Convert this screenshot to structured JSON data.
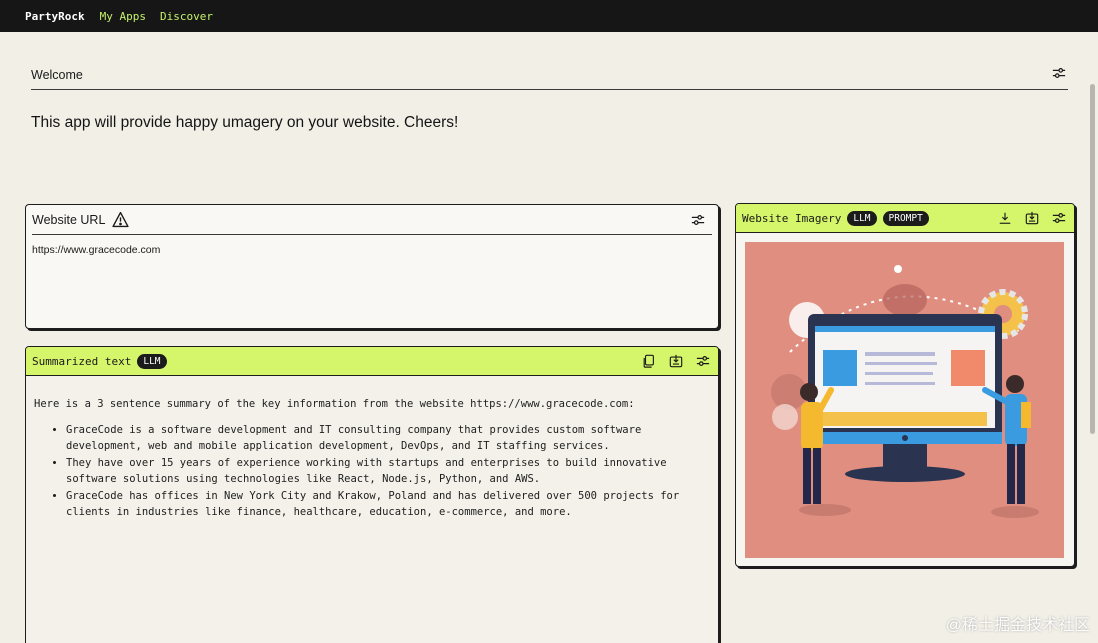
{
  "topbar": {
    "brand": "PartyRock",
    "nav": [
      "My Apps",
      "Discover"
    ]
  },
  "welcome": {
    "title": "Welcome",
    "description": "This app will provide happy umagery on your website. Cheers!"
  },
  "url_widget": {
    "title": "Website URL",
    "value": "https://www.gracecode.com"
  },
  "summary_widget": {
    "title": "Summarized text",
    "badge": "LLM",
    "intro": "Here is a 3 sentence summary of the key information from the website https://www.gracecode.com:",
    "bullets": [
      "GraceCode is a software development and IT consulting company that provides custom software development, web and mobile application development, DevOps, and IT staffing services.",
      "They have over 15 years of experience working with startups and enterprises to build innovative software solutions using technologies like React, Node.js, Python, and AWS.",
      "GraceCode has offices in New York City and Krakow, Poland and has delivered over 500 projects for clients in industries like finance, healthcare, education, e-commerce, and more."
    ]
  },
  "imagery_widget": {
    "title": "Website Imagery",
    "badges": [
      "LLM",
      "PROMPT"
    ]
  },
  "watermark": "@稀土掘金技术社区",
  "colors": {
    "accent_green": "#d5f56b",
    "nav_green": "#c6f26a",
    "topbar": "#161616",
    "background": "#f2efe7",
    "illustration_bg": "#df8e80"
  }
}
